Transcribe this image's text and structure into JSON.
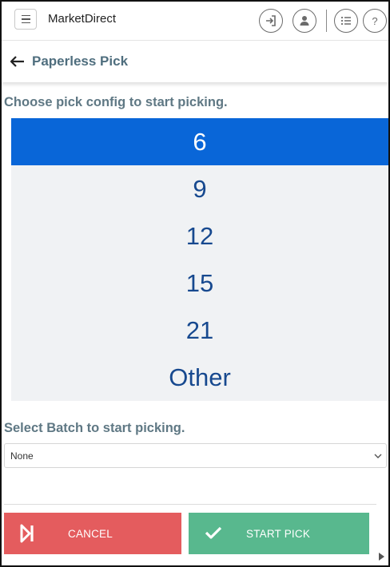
{
  "app": {
    "brand": "MarketDirect"
  },
  "navbar": {
    "icons": [
      "sign-in-icon",
      "user-icon",
      "list-icon",
      "help-icon"
    ]
  },
  "page": {
    "title": "Paperless Pick",
    "pick_config_prompt": "Choose pick config to start picking.",
    "batch_prompt": "Select Batch to start picking."
  },
  "pick_config": {
    "options": [
      "6",
      "9",
      "12",
      "15",
      "21",
      "Other"
    ],
    "selected": "6"
  },
  "batch_select": {
    "value": "None"
  },
  "actions": {
    "cancel_label": "CANCEL",
    "start_label": "START PICK"
  },
  "colors": {
    "selected_bg": "#0966d8",
    "option_text": "#17498f",
    "cancel_bg": "#e45c5e",
    "start_bg": "#58b88e",
    "title_text": "#4f6e7e"
  }
}
